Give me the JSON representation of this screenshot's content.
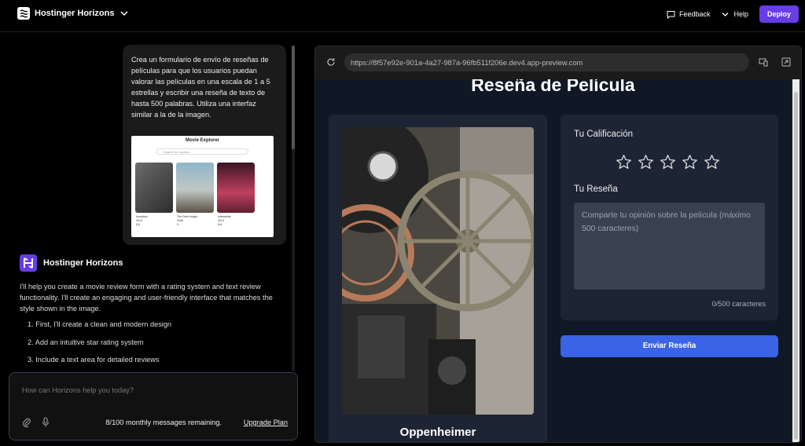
{
  "app": {
    "brand": "Hostinger Horizons",
    "feedback_label": "Feedback",
    "help_label": "Help",
    "deploy_label": "Deploy"
  },
  "chat": {
    "user_message": "Crea un formulario de envío de reseñas de películas para que los usuarios puedan valorar las películas en una escala de 1 a 5 estrellas y escribir una reseña de texto de hasta 500 palabras. Utiliza una interfaz similar a la de la imagen.",
    "attachment": {
      "title": "Movie Explorer",
      "search_placeholder": "Search for movies...",
      "cards": [
        {
          "name": "Inception",
          "year": "2010",
          "rating": "8.8"
        },
        {
          "name": "The Dark Knight",
          "year": "2008",
          "rating": "9"
        },
        {
          "name": "Interstellar",
          "year": "2014",
          "rating": "8.6"
        }
      ]
    },
    "assistant_name": "Hostinger Horizons",
    "assistant_intro": "I'll help you create a movie review form with a rating system and text review functionality. I'll create an engaging and user-friendly interface that matches the style shown in the image.",
    "steps": [
      "1. First, I'll create a clean and modern design",
      "2. Add an intuitive star rating system",
      "3. Include a text area for detailed reviews"
    ],
    "input_placeholder": "How can Horizons help you today?",
    "remaining": "8/100 monthly messages remaining.",
    "upgrade_label": "Upgrade Plan"
  },
  "preview": {
    "url": "https://8f57e92e-901a-4a27-987a-96fb511f206e.dev4.app-preview.com",
    "page_title": "Reseña de Película",
    "movie_title": "Oppenheimer",
    "rating_label": "Tu Calificación",
    "star_count": 5,
    "review_label": "Tu Reseña",
    "review_placeholder": "Comparte tu opinión sobre la película (máximo 500 caracteres)",
    "char_counter": "0/500 caracteres",
    "submit_label": "Enviar Reseña"
  },
  "colors": {
    "accent": "#673de6",
    "submit": "#3b63e6",
    "card": "#1d2535",
    "page_bg": "#101826"
  }
}
